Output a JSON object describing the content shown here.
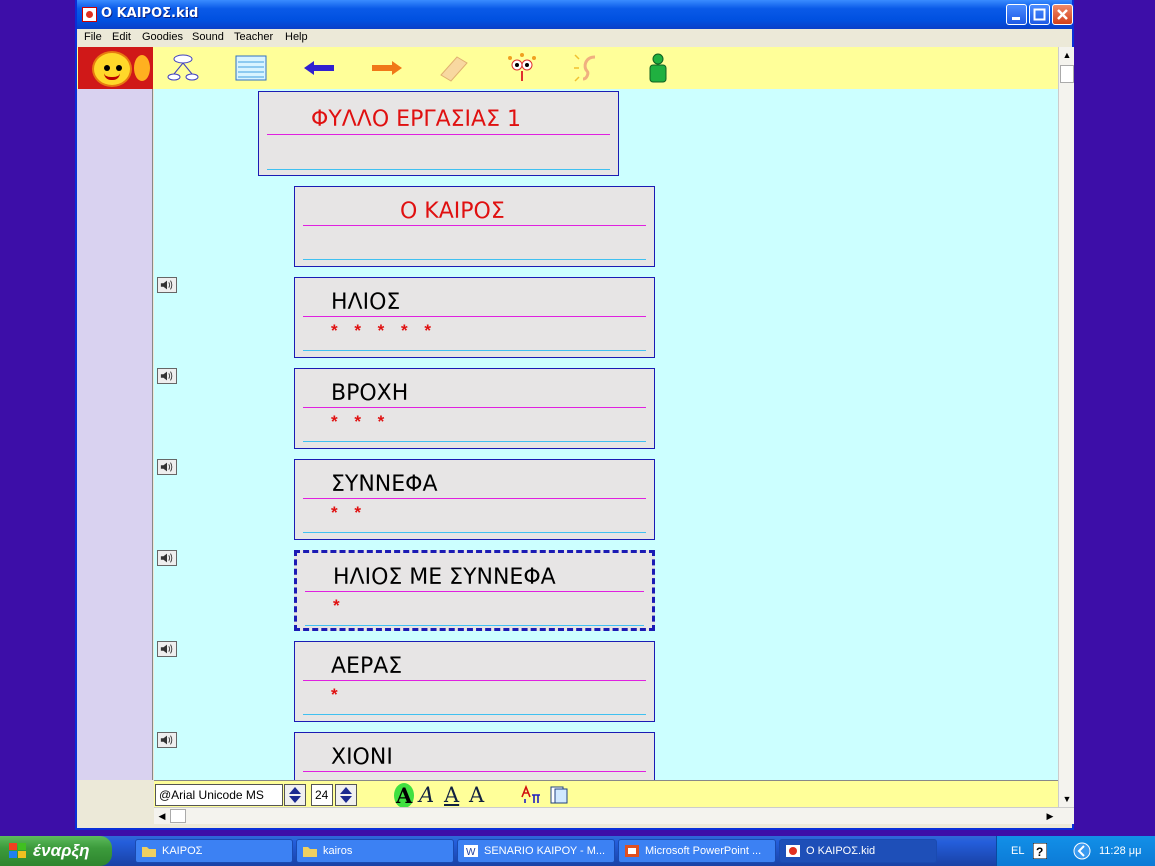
{
  "window": {
    "title": "Ο ΚΑΙΡΟΣ.kid"
  },
  "menu": [
    "File",
    "Edit",
    "Goodies",
    "Sound",
    "Teacher",
    "Help"
  ],
  "toolbar": {
    "tools": [
      "sun-logo-icon",
      "network-icon",
      "lined-paper-icon",
      "arrow-left-icon",
      "arrow-right-icon",
      "eraser-icon",
      "face-icon",
      "ear-icon",
      "person-icon"
    ]
  },
  "cards": [
    {
      "heading": "ΦΥΛΛΟ ΕΡΓΑΣΙΑΣ 1",
      "stars": "",
      "color": "#e01010"
    },
    {
      "heading": "Ο ΚΑΙΡΟΣ",
      "stars": "",
      "color": "#e01010"
    },
    {
      "heading": "ΗΛΙΟΣ",
      "stars": "* * * * *",
      "color": "#000000"
    },
    {
      "heading": "ΒΡΟΧΗ",
      "stars": "* * *",
      "color": "#000000"
    },
    {
      "heading": "ΣΥΝΝΕΦΑ",
      "stars": "* *",
      "color": "#000000"
    },
    {
      "heading": "ΗΛΙΟΣ ΜΕ ΣΥΝΝΕΦΑ",
      "stars": "*",
      "color": "#000000"
    },
    {
      "heading": "ΑΕΡΑΣ",
      "stars": "*",
      "color": "#000000"
    },
    {
      "heading": "ΧΙΟΝΙ",
      "stars": "",
      "color": "#000000"
    }
  ],
  "fontbar": {
    "font_name": "@Arial Unicode MS",
    "font_size": "24"
  },
  "taskbar": {
    "start_label": "έναρξη",
    "tasks": [
      "ΚΑΙΡΟΣ",
      "kairos",
      "SENARIO ΚΑΙΡΟΥ - M...",
      "Microsoft PowerPoint ...",
      "Ο ΚΑΙΡΟΣ.kid"
    ],
    "language": "EL",
    "clock": "11:28 μμ"
  }
}
